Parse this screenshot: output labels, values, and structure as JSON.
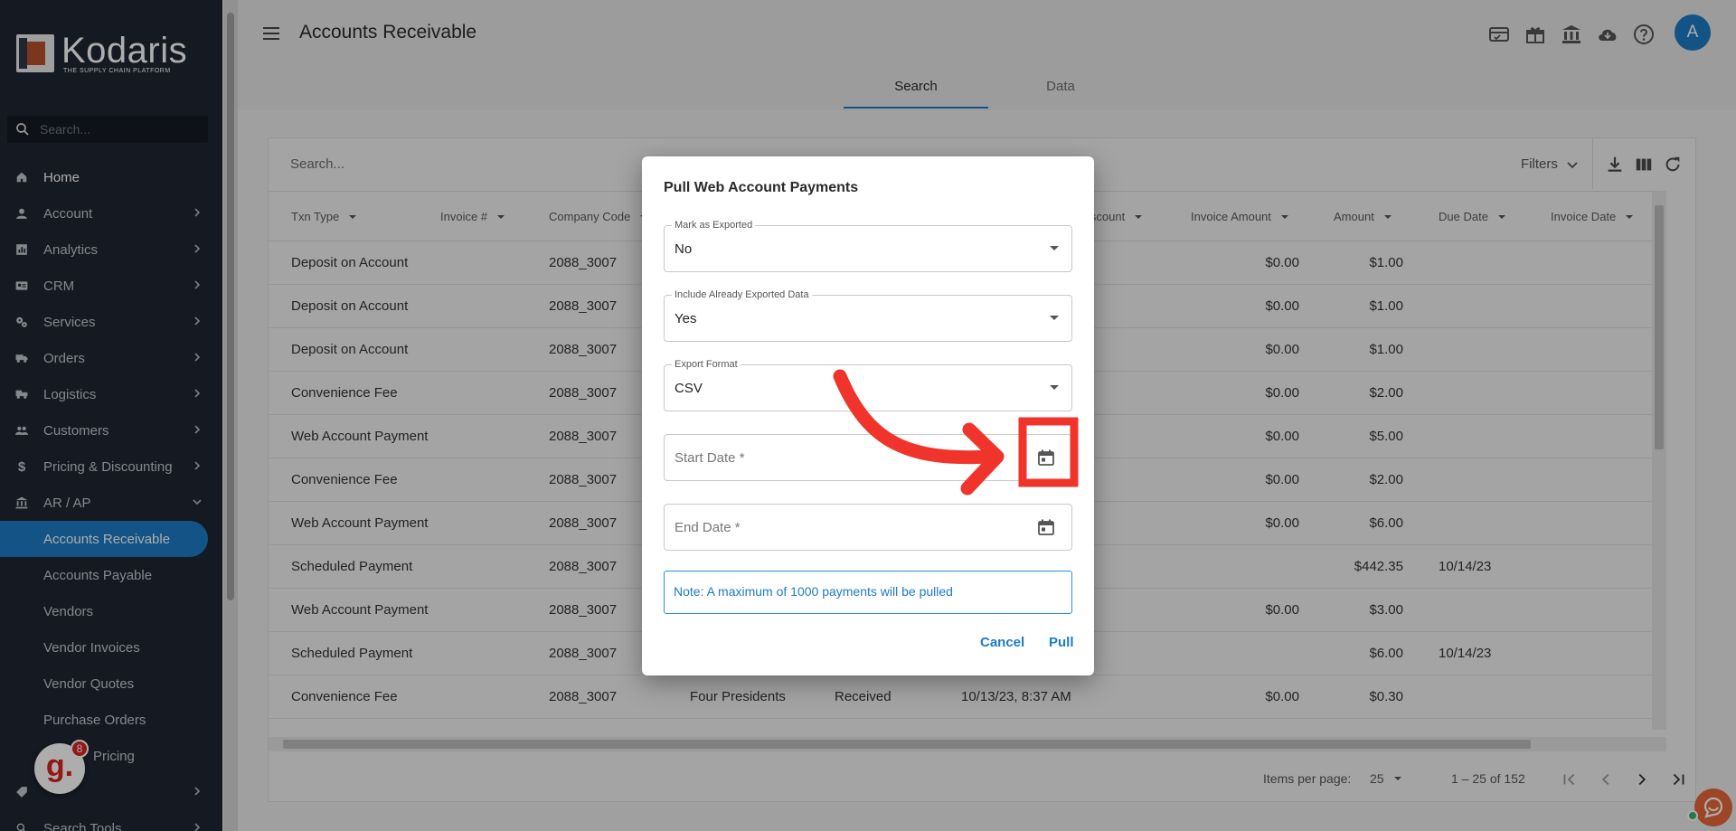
{
  "brand": {
    "name": "Kodaris",
    "tagline": "THE SUPPLY CHAIN PLATFORM"
  },
  "sidebar": {
    "search_placeholder": "Search...",
    "items": [
      {
        "label": "Home",
        "icon": "home-icon",
        "chevron": false
      },
      {
        "label": "Account",
        "icon": "person-icon",
        "chevron": true
      },
      {
        "label": "Analytics",
        "icon": "analytics-icon",
        "chevron": true
      },
      {
        "label": "CRM",
        "icon": "contact-card-icon",
        "chevron": true
      },
      {
        "label": "Services",
        "icon": "gears-icon",
        "chevron": true
      },
      {
        "label": "Orders",
        "icon": "truck-icon",
        "chevron": true
      },
      {
        "label": "Logistics",
        "icon": "shipping-icon",
        "chevron": true
      },
      {
        "label": "Customers",
        "icon": "people-icon",
        "chevron": true
      },
      {
        "label": "Pricing & Discounting",
        "icon": "dollar-icon",
        "chevron": true
      },
      {
        "label": "AR / AP",
        "icon": "bank-icon",
        "chevron": true,
        "expanded": true
      }
    ],
    "sub_items": [
      "Accounts Receivable",
      "Accounts Payable",
      "Vendors",
      "Vendor Invoices",
      "Vendor Quotes",
      "Purchase Orders",
      "Pricing"
    ],
    "active_sub": "Accounts Receivable",
    "bottom_items": [
      {
        "label": "",
        "icon": "tag-icon"
      },
      {
        "label": "Search Tools",
        "icon": "search-icon"
      }
    ]
  },
  "header": {
    "title": "Accounts Receivable",
    "avatar_letter": "A",
    "tabs": [
      "Search",
      "Data"
    ],
    "active_tab": "Search"
  },
  "table": {
    "search_placeholder": "Search...",
    "filters_label": "Filters",
    "columns": [
      "Txn Type",
      "Invoice #",
      "Company Code",
      "iscount",
      "Invoice Amount",
      "Amount",
      "Due Date",
      "Invoice Date"
    ],
    "rows": [
      {
        "txn": "Deposit on Account",
        "code": "2088_3007",
        "customer": "",
        "status": "",
        "date": "",
        "inv_amt": "$0.00",
        "amt": "$1.00",
        "due": ""
      },
      {
        "txn": "Deposit on Account",
        "code": "2088_3007",
        "customer": "",
        "status": "",
        "date": "",
        "inv_amt": "$0.00",
        "amt": "$1.00",
        "due": ""
      },
      {
        "txn": "Deposit on Account",
        "code": "2088_3007",
        "customer": "",
        "status": "",
        "date": "",
        "inv_amt": "$0.00",
        "amt": "$1.00",
        "due": ""
      },
      {
        "txn": "Convenience Fee",
        "code": "2088_3007",
        "customer": "",
        "status": "",
        "date": "",
        "inv_amt": "$0.00",
        "amt": "$2.00",
        "due": ""
      },
      {
        "txn": "Web Account Payment",
        "code": "2088_3007",
        "customer": "",
        "status": "",
        "date": "",
        "inv_amt": "$0.00",
        "amt": "$5.00",
        "due": ""
      },
      {
        "txn": "Convenience Fee",
        "code": "2088_3007",
        "customer": "",
        "status": "",
        "date": "",
        "inv_amt": "$0.00",
        "amt": "$2.00",
        "due": ""
      },
      {
        "txn": "Web Account Payment",
        "code": "2088_3007",
        "customer": "",
        "status": "",
        "date": "",
        "inv_amt": "$0.00",
        "amt": "$6.00",
        "due": ""
      },
      {
        "txn": "Scheduled Payment",
        "code": "2088_3007",
        "customer": "",
        "status": "",
        "date": "",
        "inv_amt": "",
        "amt": "$442.35",
        "due": "10/14/23"
      },
      {
        "txn": "Web Account Payment",
        "code": "2088_3007",
        "customer": "",
        "status": "",
        "date": "",
        "inv_amt": "$0.00",
        "amt": "$3.00",
        "due": ""
      },
      {
        "txn": "Scheduled Payment",
        "code": "2088_3007",
        "customer": "",
        "status": "",
        "date": "",
        "inv_amt": "",
        "amt": "$6.00",
        "due": "10/14/23"
      },
      {
        "txn": "Convenience Fee",
        "code": "2088_3007",
        "customer": "Four Presidents",
        "status": "Received",
        "date": "10/13/23, 8:37 AM",
        "inv_amt": "$0.00",
        "amt": "$0.30",
        "due": ""
      }
    ],
    "pager": {
      "items_per_page_label": "Items per page:",
      "items_per_page": "25",
      "range": "1 – 25 of 152"
    }
  },
  "dialog": {
    "title": "Pull Web Account Payments",
    "fields": [
      {
        "label": "Mark as Exported",
        "value": "No",
        "type": "select"
      },
      {
        "label": "Include Already Exported Data",
        "value": "Yes",
        "type": "select"
      },
      {
        "label": "Export Format",
        "value": "CSV",
        "type": "select"
      },
      {
        "label": "Start Date *",
        "value": "",
        "type": "date"
      },
      {
        "label": "End Date *",
        "value": "",
        "type": "date"
      }
    ],
    "note": "Note: A maximum of 1000 payments will be pulled",
    "cancel_label": "Cancel",
    "pull_label": "Pull"
  },
  "widgets": {
    "badge_count": "8"
  },
  "colors": {
    "accent": "#1d7bc5",
    "sidebar": "#1f2532",
    "annotation": "#f0342c"
  }
}
